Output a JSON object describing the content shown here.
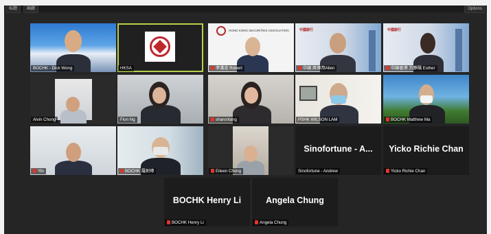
{
  "toolbar": {
    "view_label": "标题",
    "grid_label": "画廊",
    "right_label": "Options"
  },
  "colors": {
    "active_border": "#b7d24a",
    "muted_mic": "#e0352c",
    "window_bg": "#252526"
  },
  "tiles": [
    {
      "name": "BOCHK - Dick Wong",
      "muted": false
    },
    {
      "name": "HKSA",
      "muted": false,
      "active": true
    },
    {
      "name": "李漢忠 Robert",
      "muted": true
    },
    {
      "name": "中銀 區偉邦Allen",
      "muted": true
    },
    {
      "name": "中銀香港 方靜陽 Esther",
      "muted": true
    },
    {
      "name": "Alvin Chong",
      "muted": false
    },
    {
      "name": "Fion Ng",
      "muted": false
    },
    {
      "name": "sharontang",
      "muted": true
    },
    {
      "name": "PSHK WILSON LAM",
      "muted": false
    },
    {
      "name": "BOCHK Matthew Ma",
      "muted": true
    },
    {
      "name": "Yin",
      "muted": true
    },
    {
      "name": "BOCHK 羅劍璋",
      "muted": true
    },
    {
      "name": "Eileen Chong",
      "muted": true
    },
    {
      "name": "Sinofortune - Andrew",
      "muted": false,
      "big": "Sinofortune - A..."
    },
    {
      "name": "Yicko Richie Chan",
      "muted": true,
      "big": "Yicko Richie Chan"
    },
    {
      "name": "BOCHK Henry Li",
      "muted": true,
      "big": "BOCHK Henry Li"
    },
    {
      "name": "Angela Chung",
      "muted": true,
      "big": "Angela Chung"
    }
  ],
  "logos": {
    "hksa_org": "HONG KONG SECURITIES ASSOCIATION",
    "boc_short": "中國銀行"
  }
}
